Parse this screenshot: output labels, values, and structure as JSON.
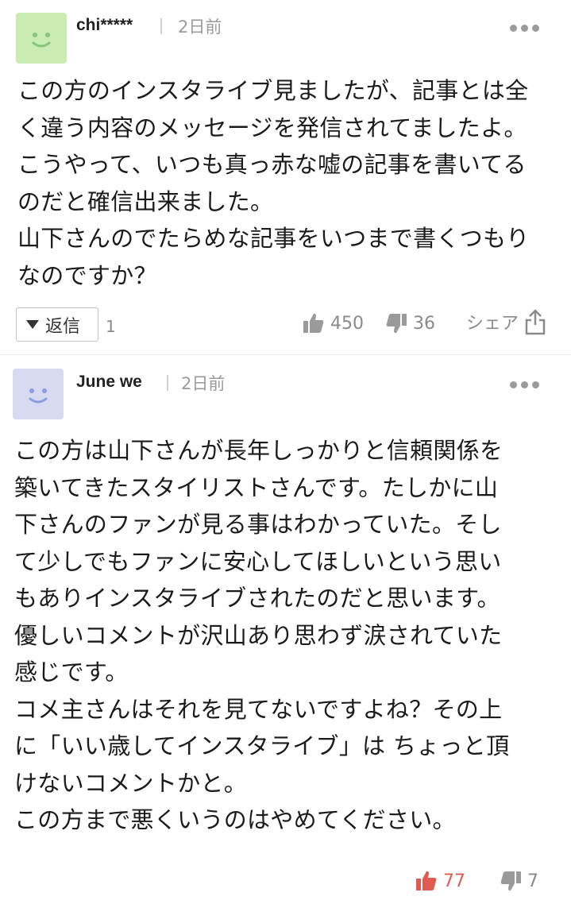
{
  "comments": [
    {
      "author": "chi*****",
      "time": "2日前",
      "avatar_color": "#c9ecb4",
      "face_color": "#86c77a",
      "body": "この方のインスタライブ見ましたが、記事とは全\nく違う内容のメッセージを発信されてましたよ。\nこうやって、いつも真っ赤な嘘の記事を書いてる\nのだと確信出来ました。\n山下さんのでたらめな記事をいつまで書くつもり\nなのですか？",
      "reply_label": "返信",
      "reply_count": "1",
      "likes": "450",
      "dislikes": "36",
      "share_label": "シェア"
    },
    {
      "author": "June we",
      "time": "2日前",
      "avatar_color": "#d6daf3",
      "face_color": "#8e9be0",
      "body": "この方は山下さんが長年しっかりと信頼関係を\n築いてきたスタイリストさんです。たしかに山\n下さんのファンが見る事はわかっていた。そし\nて少しでもファンに安心してほしいという思い\nもありインスタライブされたのだと思います。\n優しいコメントが沢山あり思わず涙されていた\n感じです。\nコメ主さんはそれを見てないですよね？その上\nに「いい歳してインスタライブ」は ちょっと頂\nけないコメントかと。\nこの方まで悪くいうのはやめてください。",
      "likes": "77",
      "dislikes": "7",
      "like_color": "#e05a50"
    }
  ]
}
